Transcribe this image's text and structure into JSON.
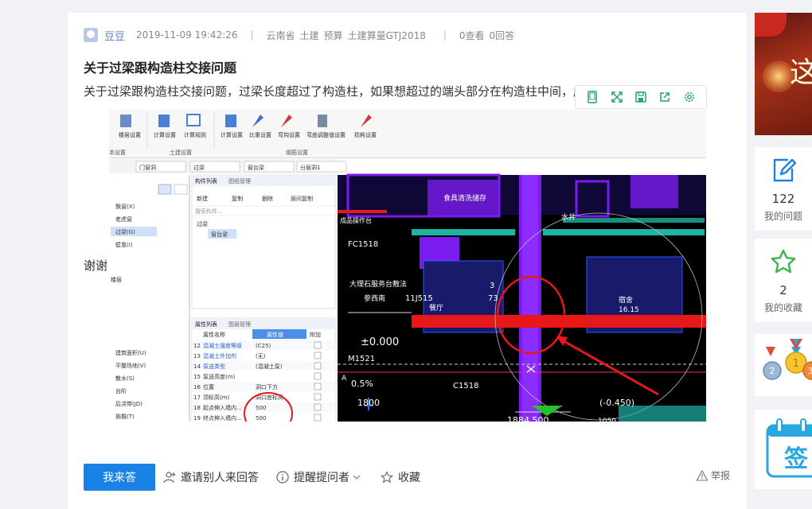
{
  "breadcrumb_fragment": "",
  "question": {
    "author": "豆豆",
    "date": "2019-11-09 19:42:26",
    "province": "云南省",
    "tags": [
      "土建",
      "预算",
      "土建算量GTJ2018"
    ],
    "views": "0查看",
    "answers": "0回答",
    "title": "关于过梁跟构造柱交接问题",
    "body": "关于过梁跟构造柱交接问题，过梁长度超过了构造柱，如果想超过的端头部分在构造柱中间，应该怎么处理？",
    "thanks": "谢谢"
  },
  "image_toolbar": [
    "mobile-icon",
    "fullscreen-icon",
    "save-icon",
    "share-icon",
    "settings-icon"
  ],
  "screenshot": {
    "ribbon": {
      "groups": [
        {
          "name": "本设置",
          "items": [
            "楼层设置"
          ]
        },
        {
          "name": "土建设置",
          "items": [
            "计算设置",
            "计算规则"
          ]
        },
        {
          "name": "钢筋设置",
          "items": [
            "计算设置",
            "比重设置",
            "弯钩设置",
            "弯曲调整值设置",
            "损耗设置"
          ]
        }
      ]
    },
    "selectors": [
      "门窗洞",
      "过梁",
      "窗台梁",
      "分层洞1"
    ],
    "nav_items": [
      "飘窗(X)",
      "老虎窗",
      "过梁(G)",
      "壁龛(I)",
      "楼层",
      "建筑面积(U)",
      "平整场地(V)",
      "散水(S)",
      "台阶",
      "后浇带(JD)",
      "挑檐(T)"
    ],
    "component_tabs": [
      "构件列表",
      "图纸管理"
    ],
    "component_actions": [
      "新建",
      "复制",
      "删除",
      "层间复制"
    ],
    "search_placeholder": "搜索构件...",
    "tree": {
      "parent": "过梁",
      "child": "窗台梁"
    },
    "property_tabs": [
      "属性列表",
      "图层管理"
    ],
    "property_headers": [
      "属性名称",
      "属性值",
      "附加"
    ],
    "properties": [
      {
        "no": "12",
        "name": "混凝土强度等级",
        "value": "(C25)"
      },
      {
        "no": "13",
        "name": "混凝土外加剂",
        "value": "(无)"
      },
      {
        "no": "14",
        "name": "泵送类型",
        "value": "(混凝土泵)"
      },
      {
        "no": "15",
        "name": "泵送高度(m)",
        "value": ""
      },
      {
        "no": "16",
        "name": "位置",
        "value": "洞口下方"
      },
      {
        "no": "17",
        "name": "顶标高(m)",
        "value": "洞口底标高"
      },
      {
        "no": "18",
        "name": "起点伸入墙内...",
        "value": "500"
      },
      {
        "no": "19",
        "name": "终点伸入墙内...",
        "value": "500"
      }
    ],
    "cad_texts": [
      "食具清洗储存",
      "成品操作台",
      "FC1518",
      "水井",
      "大理石服务台敷法",
      "参西南",
      "11J515",
      "3",
      "73",
      "餐厅",
      "宿舍",
      "16.15",
      "±0.000",
      "M1521",
      "0.5%",
      "C1518",
      "1800",
      "1884.500",
      "(-0.450)",
      "1050",
      "A"
    ]
  },
  "actions": {
    "answer_button": "我来答",
    "invite": "邀请别人来回答",
    "remind": "提醒提问者",
    "favorite": "收藏",
    "report": "举报"
  },
  "sidebar": {
    "my_questions_count": "122",
    "my_questions_label": "我的问题",
    "favorites_count": "2",
    "favorites_label": "我的收藏",
    "medal_numbers": [
      "2",
      "1",
      "3"
    ],
    "sign_char": "签",
    "banner_char": "这"
  },
  "colors": {
    "accent": "#1a82e6",
    "cad_bg": "#000000",
    "purple": "#7a1cf0",
    "red": "#e81818",
    "teal": "#1fb3a5"
  }
}
